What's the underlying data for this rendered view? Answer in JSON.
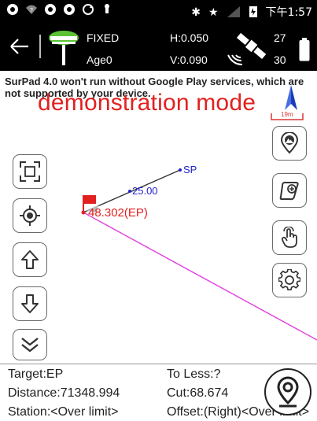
{
  "status_bar": {
    "time": "下午1:57",
    "left_icons": [
      "pinwheel-icon",
      "wifi-question-icon",
      "pinwheel-icon",
      "pinwheel-icon",
      "sync-icon",
      "usb-icon"
    ],
    "right_icons": [
      "bluetooth-icon",
      "star-icon",
      "signal-icon",
      "battery-charging-icon"
    ]
  },
  "header": {
    "fix_status": "FIXED",
    "age": "Age0",
    "h_precision": "H:0.050",
    "v_precision": "V:0.090",
    "satellites_used": "27",
    "satellites_total": "30",
    "accent_color": "#5bc236"
  },
  "map": {
    "notice": "SurPad 4.0 won't run without Google Play services, which are not supported by your device.",
    "demo_text": "demonstration mode",
    "scale_label": "19m",
    "points": {
      "sp_label": "SP",
      "mid_label": "25.00",
      "ep_label": "48.302(EP)"
    },
    "line_color": "#e040e0",
    "point_color": "#2222cc",
    "alert_color": "#e32020"
  },
  "info": {
    "target": "Target:EP",
    "to_less": "To Less:?",
    "distance": "Distance:71348.994",
    "cut": "Cut:68.674",
    "station": "Station:<Over limit>",
    "offset": "Offset:(Right)<Over limit>"
  }
}
